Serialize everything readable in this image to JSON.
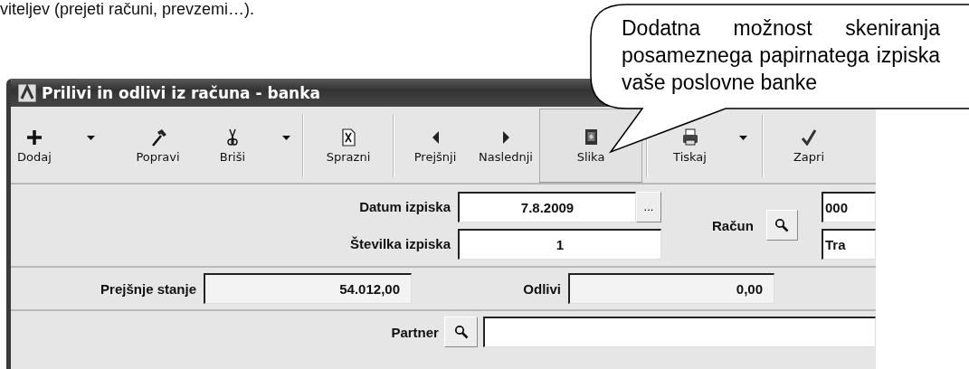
{
  "intro_text": "viteljev (prejeti računi, prevzemi…).",
  "callout": {
    "text": "Dodatna možnost skeniranja posameznega papirnatega izpiska vaše poslovne banke"
  },
  "window": {
    "title": "Prilivi in odlivi iz računa - banka"
  },
  "toolbar": [
    {
      "label": "Dodaj",
      "dropdown": true,
      "pressed": false,
      "separator_before": false
    },
    {
      "label": "Popravi",
      "dropdown": false,
      "pressed": false,
      "separator_before": false
    },
    {
      "label": "Briši",
      "dropdown": true,
      "pressed": false,
      "separator_before": false
    },
    {
      "label": "Sprazni",
      "dropdown": false,
      "pressed": false,
      "separator_before": true
    },
    {
      "label": "Prejšnji",
      "dropdown": false,
      "pressed": false,
      "separator_before": true
    },
    {
      "label": "Naslednji",
      "dropdown": false,
      "pressed": false,
      "separator_before": false
    },
    {
      "label": "Slika",
      "dropdown": false,
      "pressed": true,
      "separator_before": false
    },
    {
      "label": "Tiskaj",
      "dropdown": true,
      "pressed": false,
      "separator_before": true
    },
    {
      "label": "Zapri",
      "dropdown": false,
      "pressed": false,
      "separator_before": true
    }
  ],
  "statement": {
    "date_label": "Datum izpiska",
    "date_value": "7.8.2009",
    "date_button": "...",
    "number_label": "Številka izpiska",
    "number_value": "1",
    "account_label": "Račun",
    "account_number": "000",
    "account_name": "Tra"
  },
  "balance": {
    "previous_label": "Prejšnje stanje",
    "previous_value": "54.012,00",
    "outflow_label": "Odlivi",
    "outflow_value": "0,00"
  },
  "partner": {
    "label": "Partner"
  }
}
